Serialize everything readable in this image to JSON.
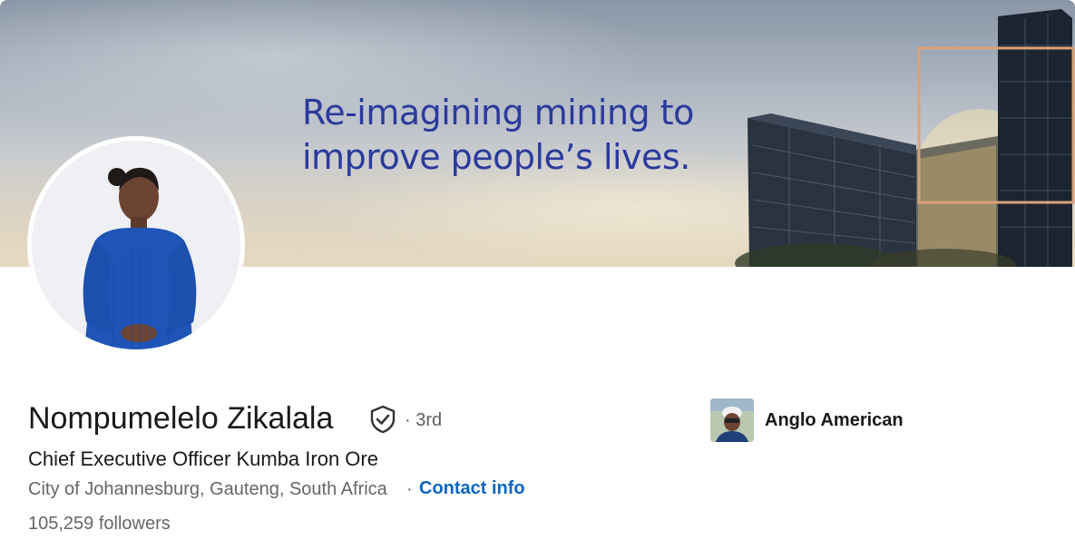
{
  "banner": {
    "tagline_line1": "Re-imagining mining to",
    "tagline_line2": "improve people’s lives."
  },
  "profile": {
    "name": "Nompumelelo Zikalala",
    "verified_icon": "shield-check-icon",
    "degree": "· 3rd",
    "headline": "Chief Executive Officer Kumba Iron Ore",
    "location": "City of Johannesburg, Gauteng, South Africa",
    "separator": "·",
    "contact_label": "Contact info",
    "followers": "105,259 followers"
  },
  "experience": {
    "company_name": "Anglo American"
  },
  "colors": {
    "link": "#0a66c2",
    "tagline": "#2b3a9c",
    "primary_text": "#191919",
    "secondary_text": "#666666"
  }
}
